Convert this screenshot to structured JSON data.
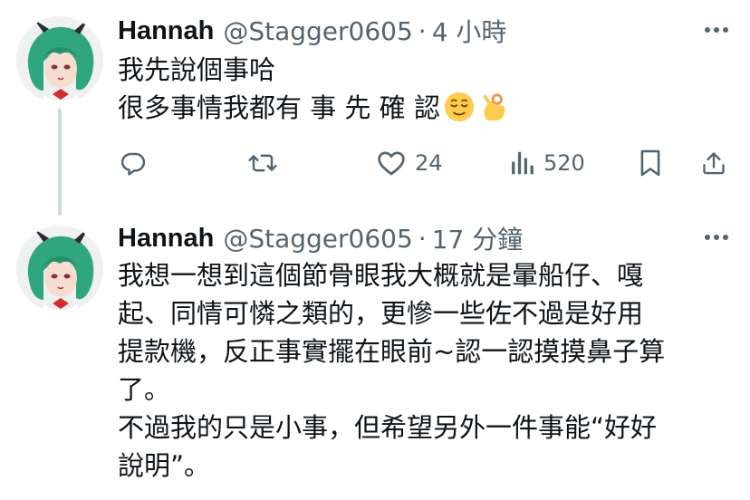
{
  "tweets": [
    {
      "author": {
        "name": "Hannah",
        "handle": "@Stagger0605",
        "separator": "·",
        "time": "4 小時"
      },
      "text_lines": [
        "我先說個事哈",
        "很多事情我都有 事 先 確 認"
      ],
      "emojis": [
        "relieved-face-emoji",
        "ok-hand-emoji"
      ],
      "actions": {
        "reply": {
          "icon": "reply-icon",
          "count": ""
        },
        "retweet": {
          "icon": "retweet-icon",
          "count": ""
        },
        "like": {
          "icon": "heart-icon",
          "count": "24"
        },
        "views": {
          "icon": "views-icon",
          "count": "520"
        },
        "bookmark": {
          "icon": "bookmark-icon"
        },
        "share": {
          "icon": "share-icon"
        }
      }
    },
    {
      "author": {
        "name": "Hannah",
        "handle": "@Stagger0605",
        "separator": "·",
        "time": "17 分鐘"
      },
      "text_lines": [
        "我想一想到這個節骨眼我大概就是暈船仔、嘎",
        "起、同情可憐之類的，更慘一些佐不過是好用",
        "提款機，反正事實擺在眼前~認一認摸摸鼻子算",
        "了。",
        "不過我的只是小事，但希望另外一件事能“好好",
        "說明”。"
      ]
    }
  ],
  "colors": {
    "text_primary": "#0f1419",
    "text_secondary": "#536471",
    "thread_line": "#cfd9de",
    "avatar_hair": "#2fa67e"
  }
}
